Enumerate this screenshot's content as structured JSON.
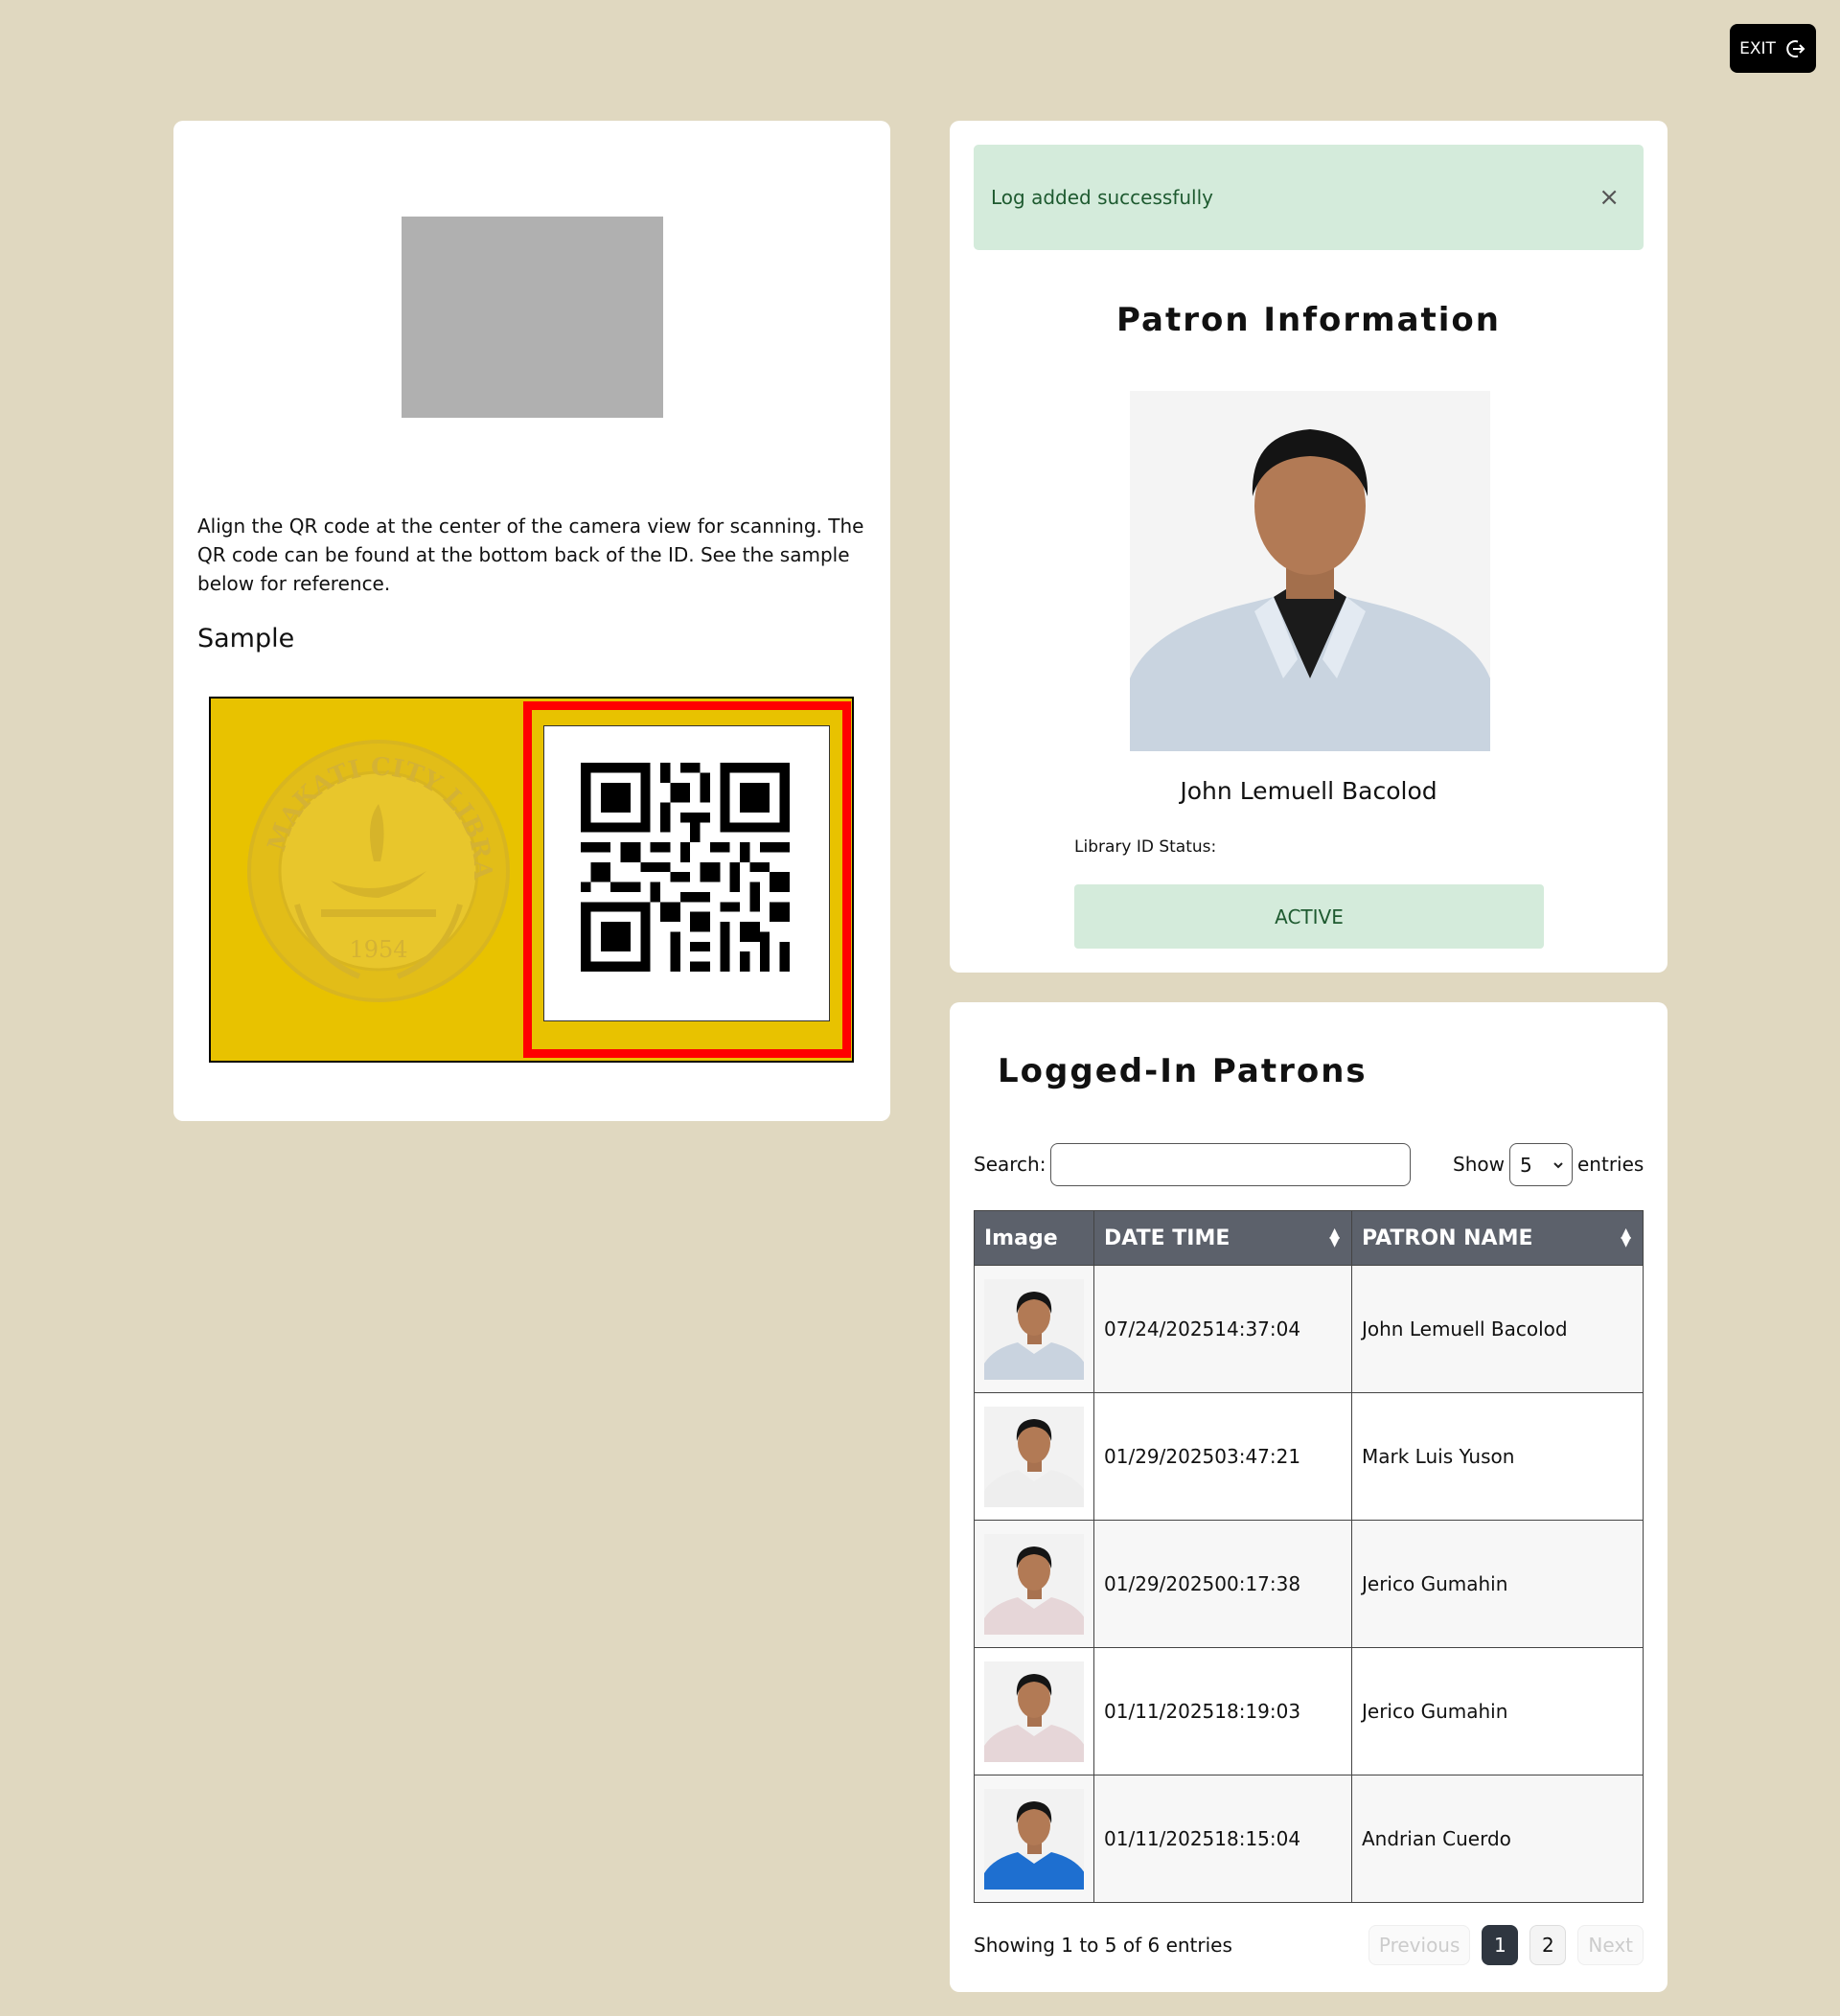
{
  "header": {
    "exit_label": "EXIT"
  },
  "scanner": {
    "instructions": "Align the QR code at the center of the camera view for scanning. The QR code can be found at the bottom back of the ID. See the sample below for reference.",
    "sample_title": "Sample",
    "seal_text": "MAKATI CITY LIBRARY",
    "seal_year": "1954"
  },
  "alert": {
    "message": "Log added successfully",
    "close": "×"
  },
  "patron": {
    "title": "Patron Information",
    "name": "John Lemuell Bacolod",
    "status_label": "Library ID Status:",
    "status_value": "ACTIVE"
  },
  "logged": {
    "title": "Logged-In Patrons",
    "search_label": "Search:",
    "search_value": "",
    "show_label": "Show",
    "entries_value": "5",
    "entries_label": "entries",
    "columns": [
      "Image",
      "DATE TIME",
      "PATRON NAME"
    ],
    "rows": [
      {
        "datetime": "07/24/202514:37:04",
        "name": "John Lemuell Bacolod",
        "shirt": "#c9d3df"
      },
      {
        "datetime": "01/29/202503:47:21",
        "name": "Mark Luis Yuson",
        "shirt": "#eeeeee"
      },
      {
        "datetime": "01/29/202500:17:38",
        "name": "Jerico Gumahin",
        "shirt": "#e6d6d8"
      },
      {
        "datetime": "01/11/202518:19:03",
        "name": "Jerico Gumahin",
        "shirt": "#e6d6d8"
      },
      {
        "datetime": "01/11/202518:15:04",
        "name": "Andrian Cuerdo",
        "shirt": "#1e6fd0"
      }
    ],
    "showing": "Showing 1 to 5 of 6 entries",
    "pagination": {
      "previous": "Previous",
      "pages": [
        "1",
        "2"
      ],
      "current": "1",
      "next": "Next"
    }
  },
  "colors": {
    "background": "#e0d8c0",
    "success_bg": "#d4ebdb",
    "success_text": "#1e5a30",
    "table_header": "#5c616b",
    "id_card": "#e8c200",
    "qr_highlight": "#ff0000"
  }
}
